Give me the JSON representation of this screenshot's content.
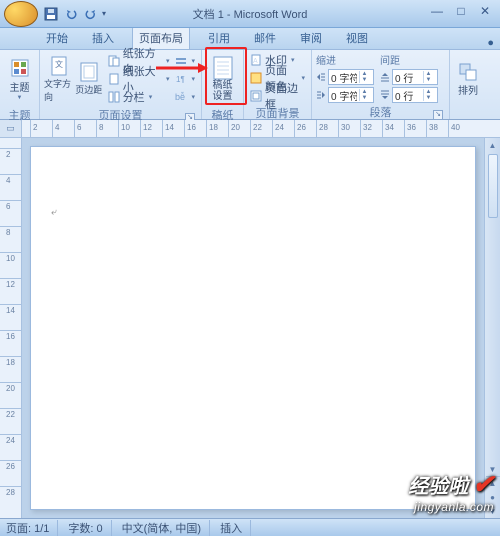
{
  "title": "文档 1 - Microsoft Word",
  "qat": {
    "save": "save",
    "undo": "undo",
    "redo": "redo"
  },
  "tabs": {
    "items": [
      "开始",
      "插入",
      "页面布局",
      "引用",
      "邮件",
      "审阅",
      "视图"
    ],
    "activeIndex": 2,
    "help": "●"
  },
  "ribbon": {
    "themes": {
      "label": "主题",
      "btn": "主题"
    },
    "pageSetup": {
      "label": "页面设置",
      "margins": "文字方向",
      "orientation": "页边距",
      "size": "纸张方向",
      "paper": "纸张大小",
      "columns": "分栏",
      "breaks": "bd"
    },
    "manuscript": {
      "label": "稿纸",
      "btn1": "稿纸",
      "btn2": "设置"
    },
    "pageBg": {
      "label": "页面背景",
      "watermark": "水印",
      "pageColor": "页面颜色",
      "pageBorder": "页面边框"
    },
    "paragraph": {
      "label": "段落",
      "indent": "缩进",
      "spacing": "间距",
      "leftLabel": "左",
      "leftValue": "0 字符",
      "rightLabel": "右",
      "rightValue": "0 字符",
      "beforeLabel": "前",
      "beforeValue": "0 行",
      "afterLabel": "后",
      "afterValue": "0 行"
    },
    "arrange": {
      "label": "排列",
      "btn": "排列"
    }
  },
  "ruler": {
    "marks": [
      2,
      4,
      6,
      8,
      10,
      12,
      14,
      16,
      18,
      20,
      22,
      24,
      26,
      28,
      30,
      32,
      34,
      36,
      38,
      40
    ]
  },
  "vruler": {
    "marks": [
      2,
      4,
      6,
      8,
      10,
      12,
      14,
      16,
      18,
      20,
      22,
      24,
      26,
      28
    ]
  },
  "status": {
    "page": "页面: 1/1",
    "words": "字数: 0",
    "lang": "中文(简体, 中国)",
    "mode": "插入"
  },
  "watermark": {
    "line1": "经验啦",
    "line2": "jingyanla.com"
  },
  "colors": {
    "accent": "#365f91",
    "highlight": "#e22"
  }
}
